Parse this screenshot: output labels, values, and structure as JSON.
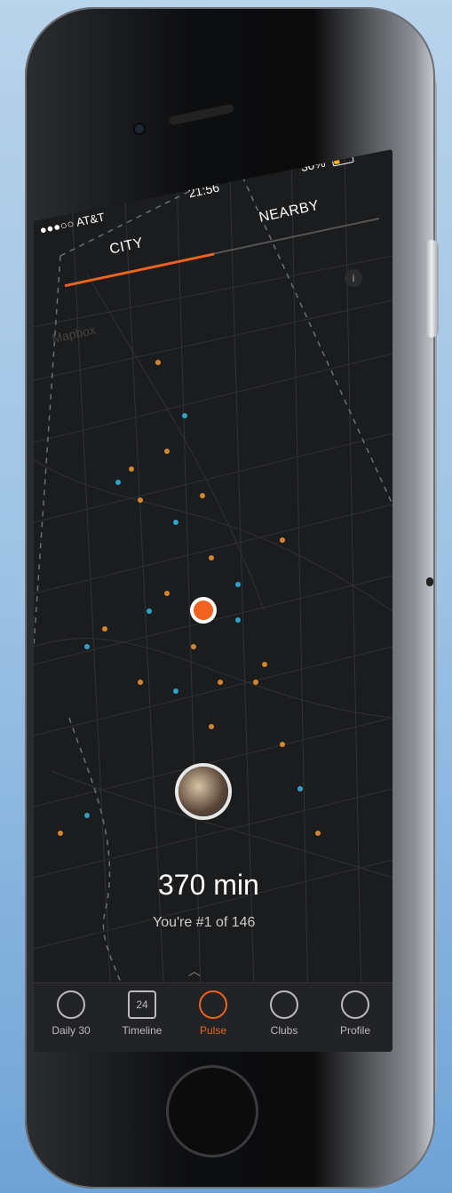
{
  "status": {
    "carrier": "●●●○○ AT&T",
    "time": "21:56",
    "battery": "30%"
  },
  "tabs": {
    "city": "CITY",
    "nearby": "NEARBY"
  },
  "map": {
    "attribution": "Mapbox",
    "info": "i"
  },
  "summary": {
    "minutes": "370 min",
    "rank": "You're #1 of 146"
  },
  "tabbar": {
    "daily": "Daily 30",
    "timeline": "Timeline",
    "timeline_date": "24",
    "pulse": "Pulse",
    "clubs": "Clubs",
    "profile": "Profile"
  },
  "colors": {
    "accent": "#f2611d",
    "secondary": "#2ea3c7",
    "amber": "#d4862e"
  }
}
